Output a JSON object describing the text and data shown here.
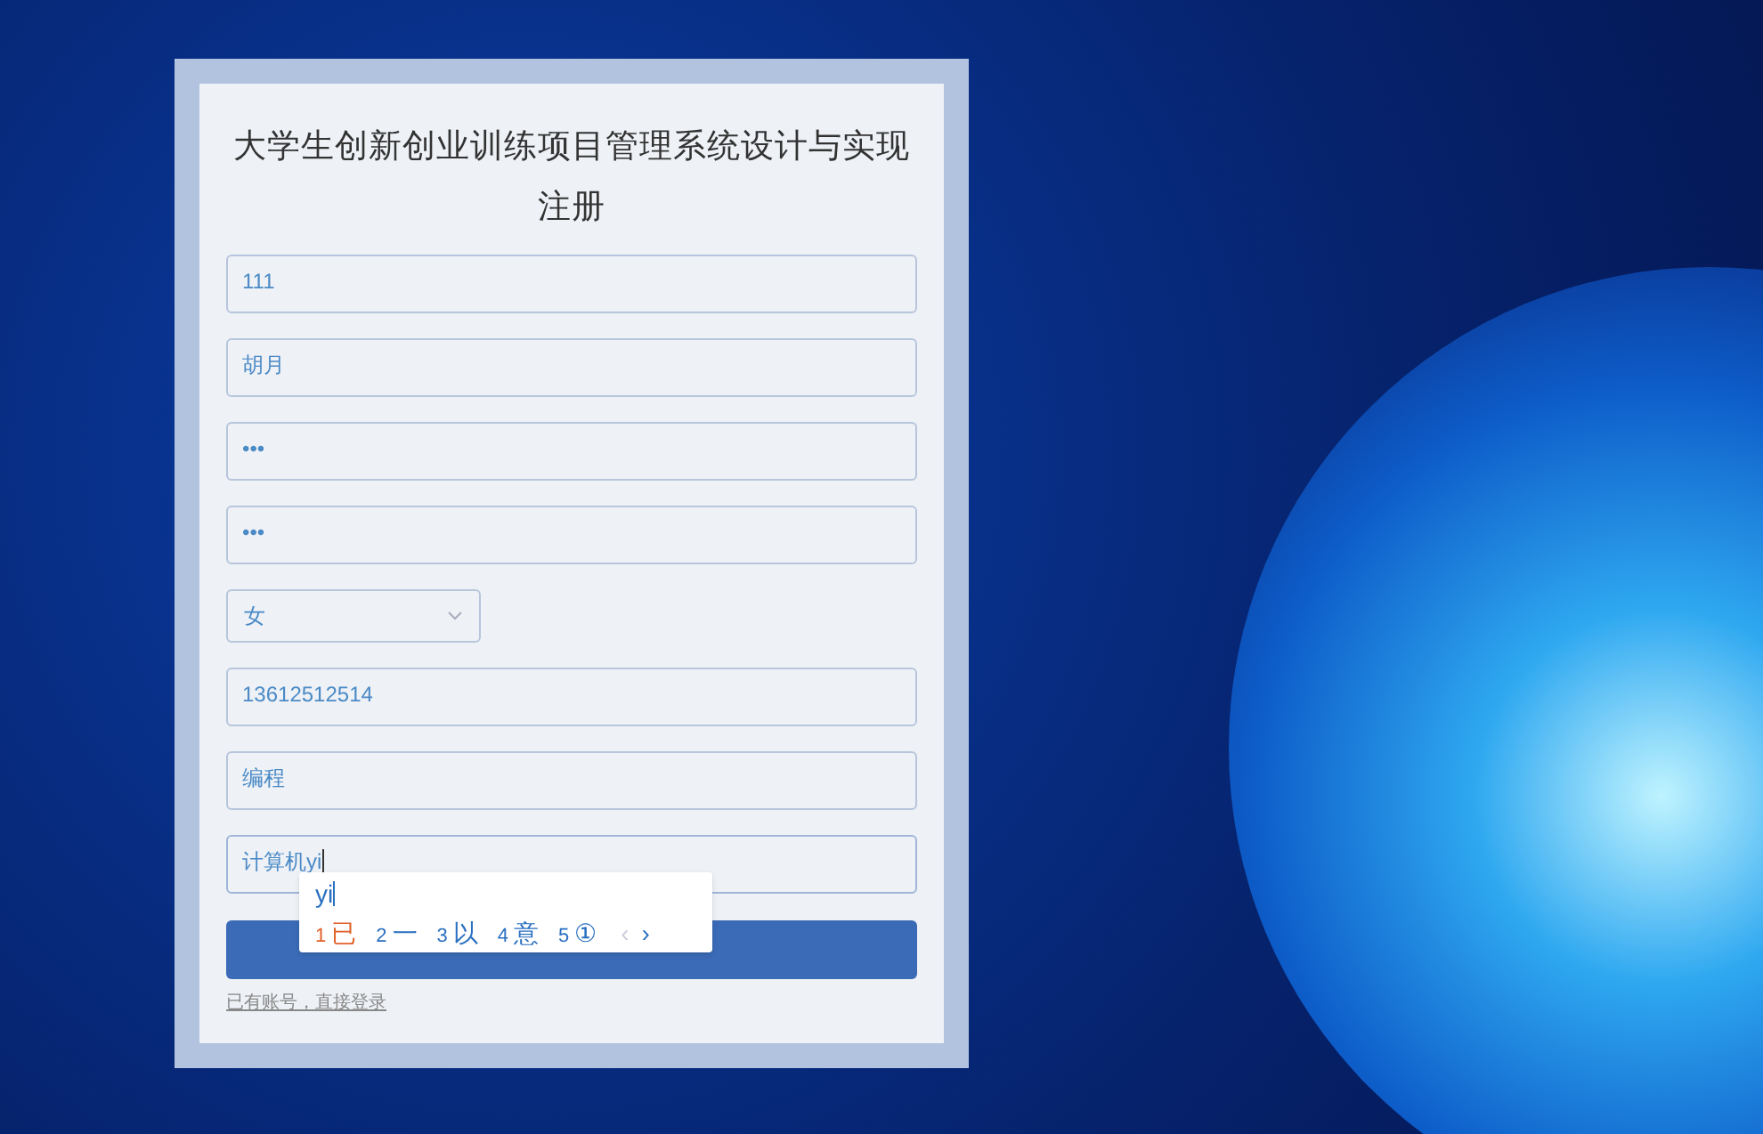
{
  "title": "大学生创新创业训练项目管理系统设计与实现注册",
  "fields": [
    {
      "kind": "input",
      "value": "111",
      "focused": false
    },
    {
      "kind": "input",
      "value": "胡月",
      "focused": false
    },
    {
      "kind": "input",
      "value": "•••",
      "focused": false
    },
    {
      "kind": "input",
      "value": "•••",
      "focused": false
    },
    {
      "kind": "select",
      "value": "女"
    },
    {
      "kind": "input",
      "value": "13612512514",
      "focused": false
    },
    {
      "kind": "input",
      "value": "编程",
      "focused": false
    },
    {
      "kind": "input",
      "value": "计算机yi",
      "focused": true
    }
  ],
  "ime": {
    "composition": "yi",
    "candidates": [
      {
        "number": "1",
        "text": "已",
        "selected": true
      },
      {
        "number": "2",
        "text": "一",
        "selected": false
      },
      {
        "number": "3",
        "text": "以",
        "selected": false
      },
      {
        "number": "4",
        "text": "意",
        "selected": false
      },
      {
        "number": "5",
        "text": "①",
        "selected": false
      }
    ],
    "prev": "‹",
    "next": "›"
  },
  "login_link": "已有账号，直接登录"
}
